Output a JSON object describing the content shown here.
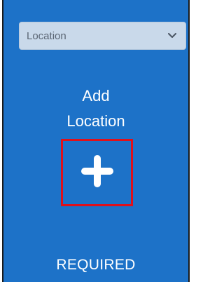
{
  "location_select": {
    "value": "Location",
    "icon": "chevron-down-icon"
  },
  "add_location": {
    "label_line1": "Add",
    "label_line2": "Location",
    "icon": "plus-icon"
  },
  "required_label": "REQUIRED",
  "colors": {
    "panel_background": "#1d72c8",
    "select_background": "#c9d9ea",
    "highlight_border": "#e0101a",
    "text": "#ffffff"
  }
}
